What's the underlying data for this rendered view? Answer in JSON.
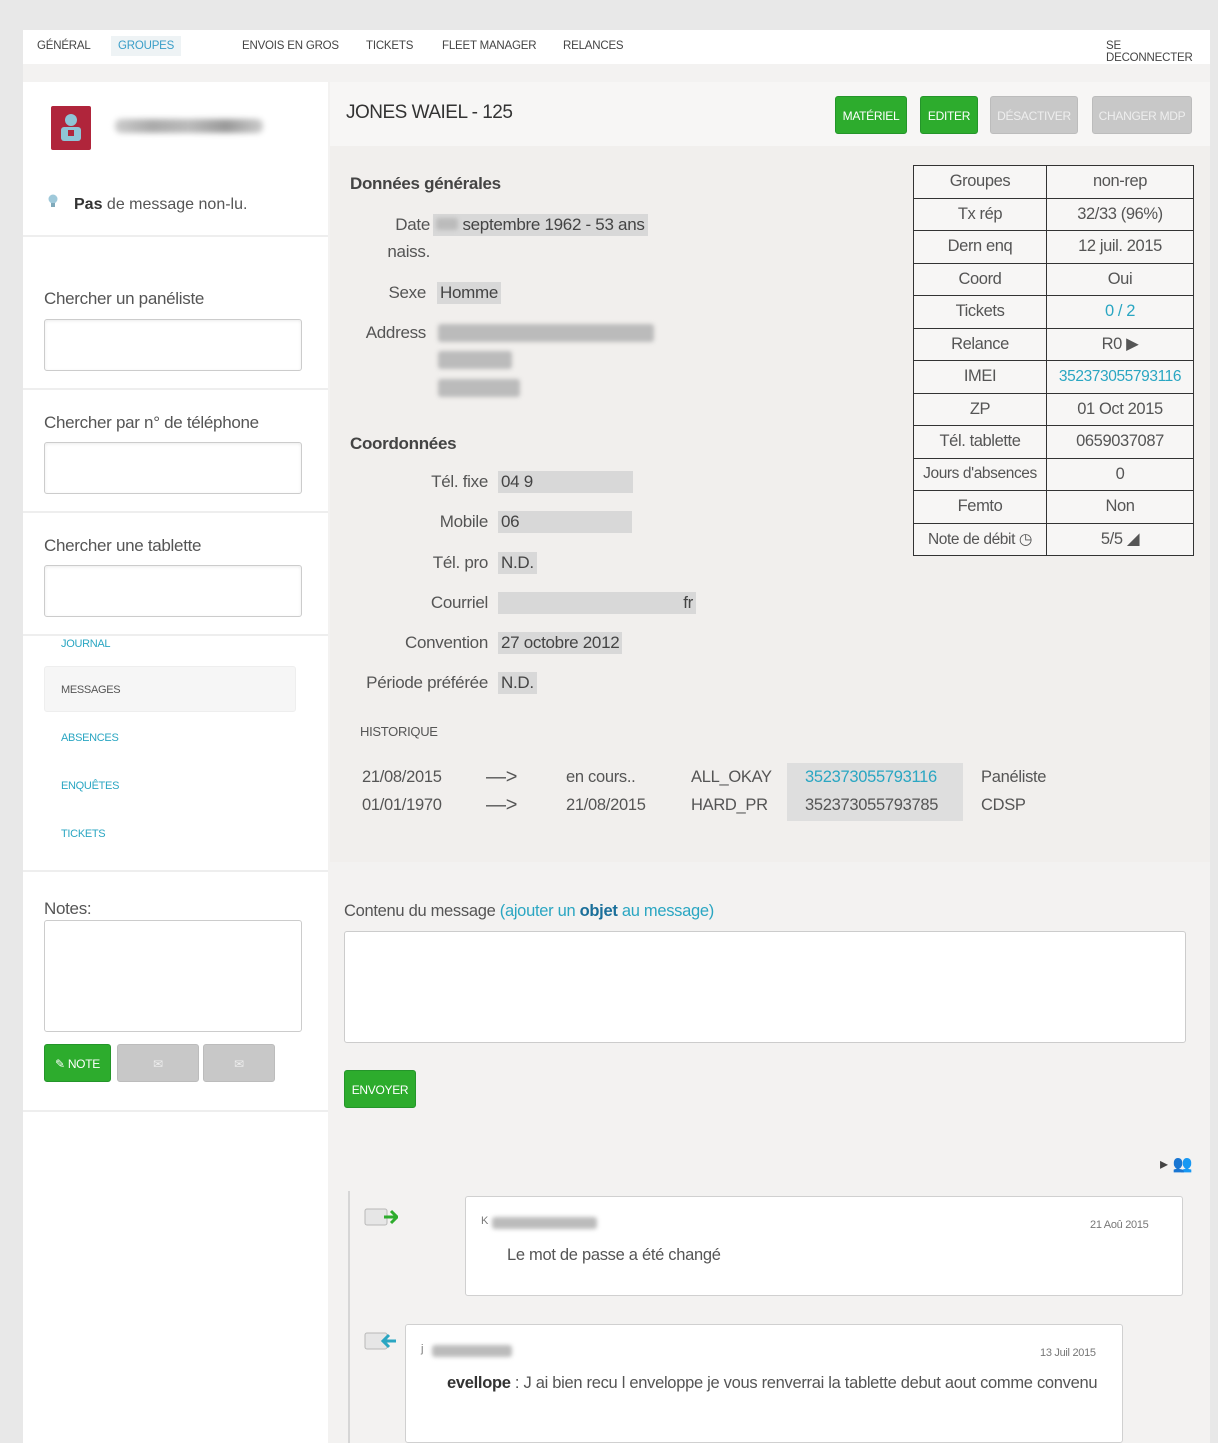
{
  "nav": {
    "items": [
      "GÉNÉRAL",
      "GROUPES",
      "ENVOIS EN GROS",
      "TICKETS",
      "FLEET MANAGER",
      "RELANCES"
    ],
    "logout": "SE DECONNECTER"
  },
  "sidebar": {
    "unread_bold": "Pas",
    "unread_rest": " de message non-lu.",
    "search_panelist_label": "Chercher un panéliste",
    "search_phone_label": "Chercher par n° de téléphone",
    "search_tablet_label": "Chercher une tablette",
    "subnav": [
      "JOURNAL",
      "MESSAGES",
      "ABSENCES",
      "ENQUÊTES",
      "TICKETS"
    ],
    "notes_label": "Notes:",
    "note_button": "✎ NOTE",
    "btn2": "",
    "btn3": ""
  },
  "header": {
    "title": "JONES WAIEL - 125",
    "actions": [
      "MATÉRIEL",
      "EDITER",
      "DÉSACTIVER",
      "CHANGER MDP"
    ]
  },
  "general": {
    "section": "Données générales",
    "dob_label_1": "Date",
    "dob_label_2": "naiss.",
    "dob_value": "septembre 1962 - 53 ans",
    "sex_label": "Sexe",
    "sex_value": "Homme",
    "address_label": "Address"
  },
  "contact": {
    "section": "Coordonnées",
    "fixe_label": "Tél. fixe",
    "fixe_value": "04 9",
    "mobile_label": "Mobile",
    "mobile_value": "06",
    "pro_label": "Tél. pro",
    "pro_value": "N.D.",
    "email_label": "Courriel",
    "email_value": "fr",
    "convention_label": "Convention",
    "convention_value": "27 octobre 2012",
    "period_label": "Période préférée",
    "period_value": "N.D."
  },
  "history": {
    "title": "HISTORIQUE",
    "rows": [
      {
        "from": "21/08/2015",
        "arrow": "—>",
        "to": "en cours..",
        "status": "ALL_OKAY",
        "imei": "352373055793116",
        "role": "Panéliste"
      },
      {
        "from": "01/01/1970",
        "arrow": "—>",
        "to": "21/08/2015",
        "status": "HARD_PR",
        "imei": "352373055793785",
        "role": "CDSP"
      }
    ]
  },
  "info": [
    {
      "k": "Groupes",
      "v": "non-rep"
    },
    {
      "k": "Tx rép",
      "v": "32/33 (96%)"
    },
    {
      "k": "Dern enq",
      "v": "12 juil. 2015"
    },
    {
      "k": "Coord",
      "v": "Oui"
    },
    {
      "k": "Tickets",
      "v": "0 / 2"
    },
    {
      "k": "Relance",
      "v": "R0 ▶"
    },
    {
      "k": "IMEI",
      "v": "352373055793116"
    },
    {
      "k": "ZP",
      "v": "01 Oct 2015"
    },
    {
      "k": "Tél. tablette",
      "v": "0659037087"
    },
    {
      "k": "Jours d'absences",
      "v": "0"
    },
    {
      "k": "Femto",
      "v": "Non"
    },
    {
      "k": "Note de débit",
      "v": "5/5"
    }
  ],
  "message": {
    "label": "Contenu du message ",
    "link_open": "(ajouter un ",
    "link_bold": "objet",
    "link_close": " au message)",
    "send": "ENVOYER"
  },
  "feed": [
    {
      "author": "K",
      "date": "21 Aoû 2015",
      "text": "Le mot de passe a été changé"
    },
    {
      "author": "j",
      "date": "13 Juil 2015",
      "bold": "evellope",
      "text": " : J ai bien recu l enveloppe je vous renverrai la tablette debut aout comme convenu"
    }
  ],
  "colors": {
    "accent": "#2aa6c2",
    "green": "#2dac2d",
    "brand": "#b0253b"
  }
}
